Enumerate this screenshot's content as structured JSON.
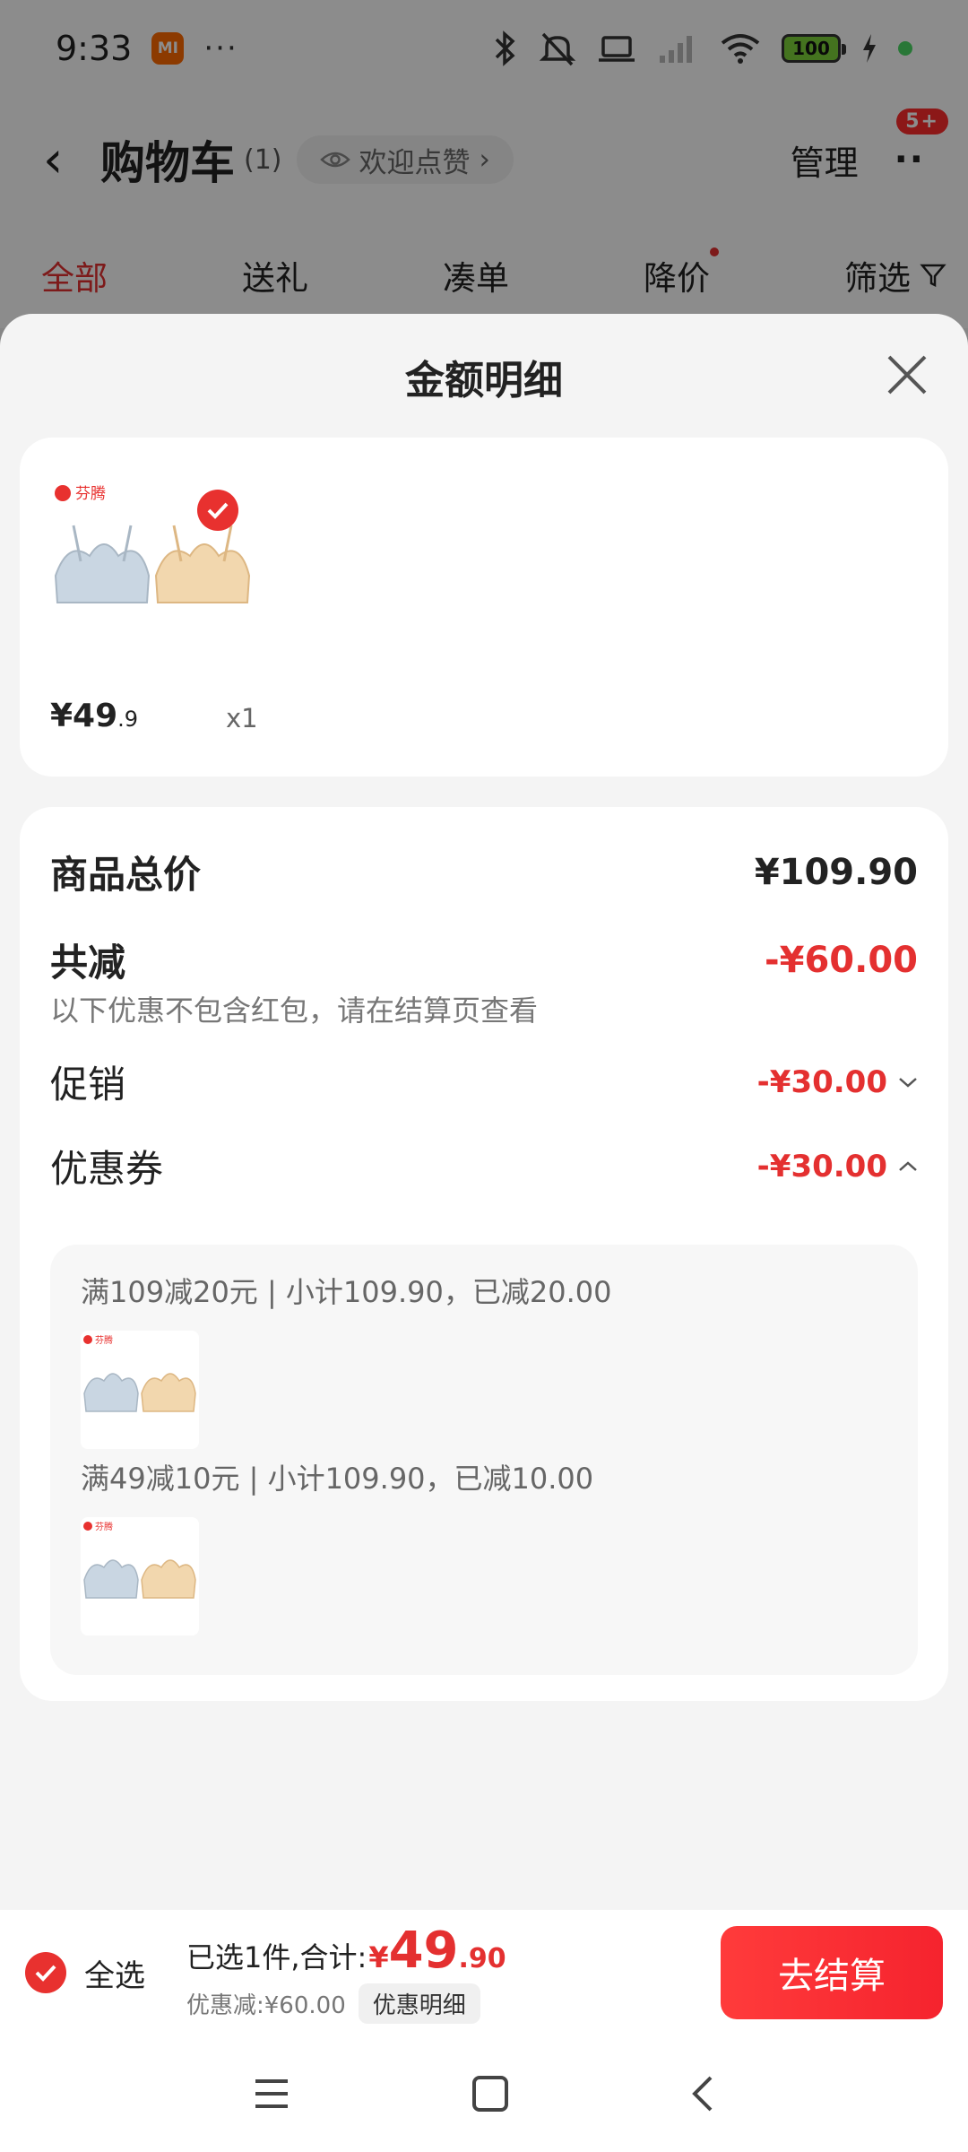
{
  "status_bar": {
    "time": "9:33",
    "mi_badge": "MI",
    "dots": "···",
    "battery": "100"
  },
  "nav": {
    "back_icon": "‹",
    "title": "购物车",
    "count": "(1)",
    "welcome_pill": "欢迎点赞",
    "pill_arrow": "›",
    "manage": "管理",
    "more": "··",
    "badge": "5+"
  },
  "tabs": [
    {
      "label": "全部",
      "active": true
    },
    {
      "label": "送礼",
      "active": false
    },
    {
      "label": "凑单",
      "active": false
    },
    {
      "label": "降价",
      "active": false,
      "dot": true
    },
    {
      "label": "筛选",
      "active": false,
      "icon": "filter-icon"
    }
  ],
  "sheet": {
    "title": "金额明细",
    "product": {
      "brand": "芬腾",
      "price_main": "¥49",
      "price_decimal": ".9",
      "qty": "x1"
    },
    "summary": {
      "total_label": "商品总价",
      "total_value": "¥109.90",
      "discount_label": "共减",
      "discount_value": "-¥60.00",
      "discount_note": "以下优惠不包含红包，请在结算页查看",
      "promo_label": "促销",
      "promo_value": "-¥30.00",
      "coupon_label": "优惠券",
      "coupon_value": "-¥30.00",
      "coupon_rules": [
        "满109减20元 | 小计109.90，已减20.00",
        "满49减10元 | 小计109.90，已减10.00"
      ]
    }
  },
  "bottom_bar": {
    "select_all": "全选",
    "selected_text": "已选1件,合计:",
    "currency": "¥",
    "total_int": "49",
    "total_dec": ".90",
    "saving": "优惠减:¥60.00",
    "detail_chip": "优惠明细",
    "checkout": "去结算"
  },
  "colors": {
    "accent": "#e43030",
    "checkout": "#f5232e"
  }
}
